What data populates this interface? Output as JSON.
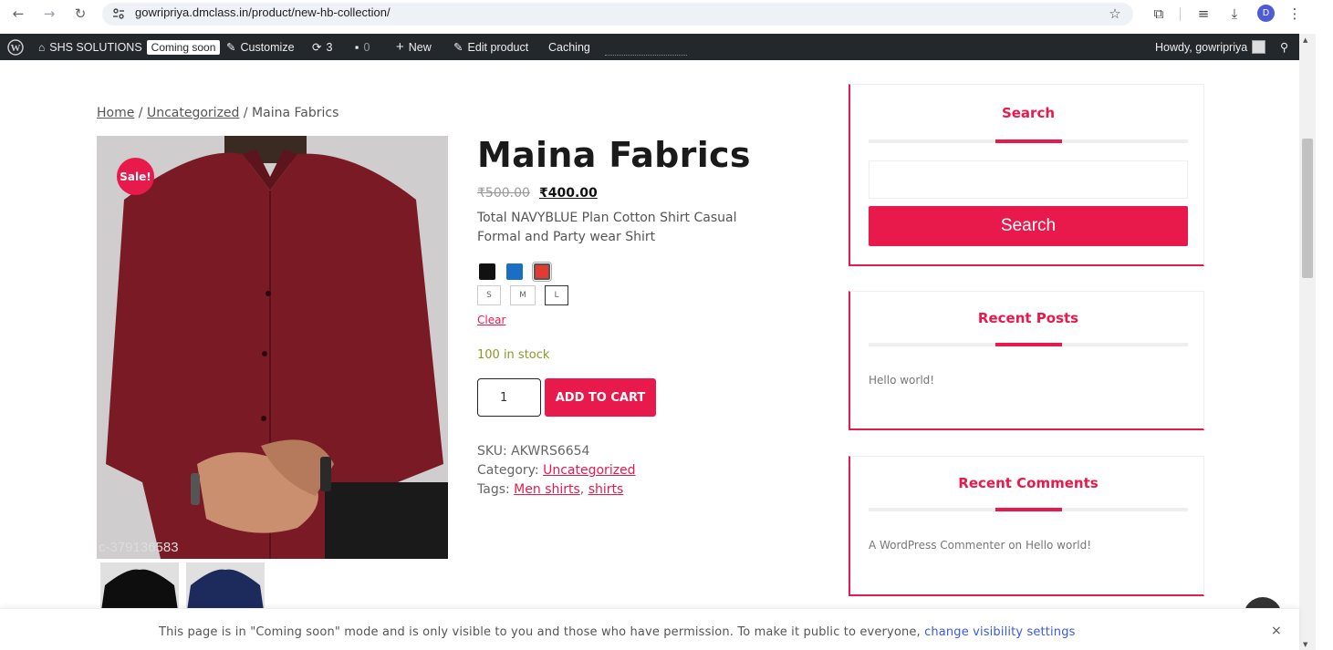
{
  "browser": {
    "url": "gowripriya.dmclass.in/product/new-hb-collection/",
    "profile_initial": "D"
  },
  "adminbar": {
    "site_name": "SHS SOLUTIONS",
    "coming_soon": "Coming soon",
    "customize": "Customize",
    "updates": "3",
    "comments": "0",
    "new": "New",
    "edit_product": "Edit product",
    "caching": "Caching",
    "howdy": "Howdy, gowripriya"
  },
  "breadcrumb": {
    "home": "Home",
    "sep1": "/",
    "category": "Uncategorized",
    "sep2": "/",
    "current": "Maina Fabrics"
  },
  "product": {
    "sale_badge": "Sale!",
    "image_code": "c-379136583",
    "title": "Maina Fabrics",
    "price_old": "₹500.00",
    "price_new": "₹400.00",
    "description": "Total NAVYBLUE Plan Cotton Shirt Casual Formal and Party wear Shirt",
    "colors": [
      "#111111",
      "#1a6fc4",
      "#e53a32"
    ],
    "sizes": [
      "S",
      "M",
      "L"
    ],
    "clear": "Clear",
    "stock": "100 in stock",
    "quantity": "1",
    "add_to_cart": "ADD TO CART",
    "sku_label": "SKU:",
    "sku": "AKWRS6654",
    "category_label": "Category:",
    "category": "Uncategorized",
    "tags_label": "Tags:",
    "tag1": "Men shirts",
    "tag_sep": ",",
    "tag2": "shirts"
  },
  "sidebar": {
    "search_title": "Search",
    "search_button": "Search",
    "recent_posts_title": "Recent Posts",
    "recent_post": "Hello world!",
    "recent_comments_title": "Recent Comments",
    "recent_comment": "A WordPress Commenter on Hello world!"
  },
  "notice": {
    "text": "This page is in \"Coming soon\" mode and is only visible to you and those who have permission. To make it public to everyone,",
    "link": "change visibility settings",
    "close": "×"
  },
  "colors": {
    "accent": "#e8194b",
    "adminbar": "#23282d",
    "stock": "#8a9a27"
  }
}
